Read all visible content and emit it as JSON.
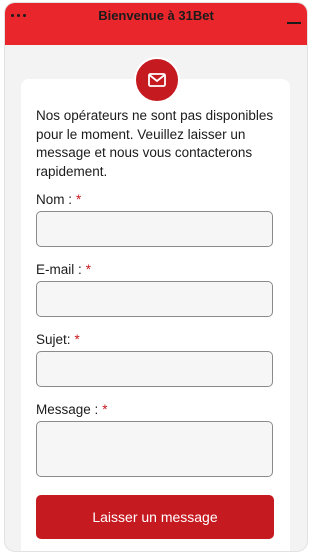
{
  "header": {
    "title": "Bienvenue à 31Bet",
    "menu_icon": "more-dots-icon",
    "minimize_icon": "minimize-icon"
  },
  "badge": {
    "icon": "mail-icon"
  },
  "form": {
    "intro": "Nos opérateurs ne sont pas disponibles pour le moment. Veuillez laisser un message et nous vous contacterons rapidement.",
    "required_mark": "*",
    "fields": [
      {
        "label": "Nom :",
        "value": "",
        "placeholder": ""
      },
      {
        "label": "E-mail :",
        "value": "",
        "placeholder": ""
      },
      {
        "label": "Sujet:",
        "value": "",
        "placeholder": ""
      },
      {
        "label": "Message :",
        "value": "",
        "placeholder": ""
      }
    ],
    "submit_label": "Laisser un message"
  },
  "colors": {
    "header_bg": "#e8262b",
    "accent": "#c61a21",
    "panel_bg": "#f3f3f3",
    "card_bg": "#ffffff"
  }
}
